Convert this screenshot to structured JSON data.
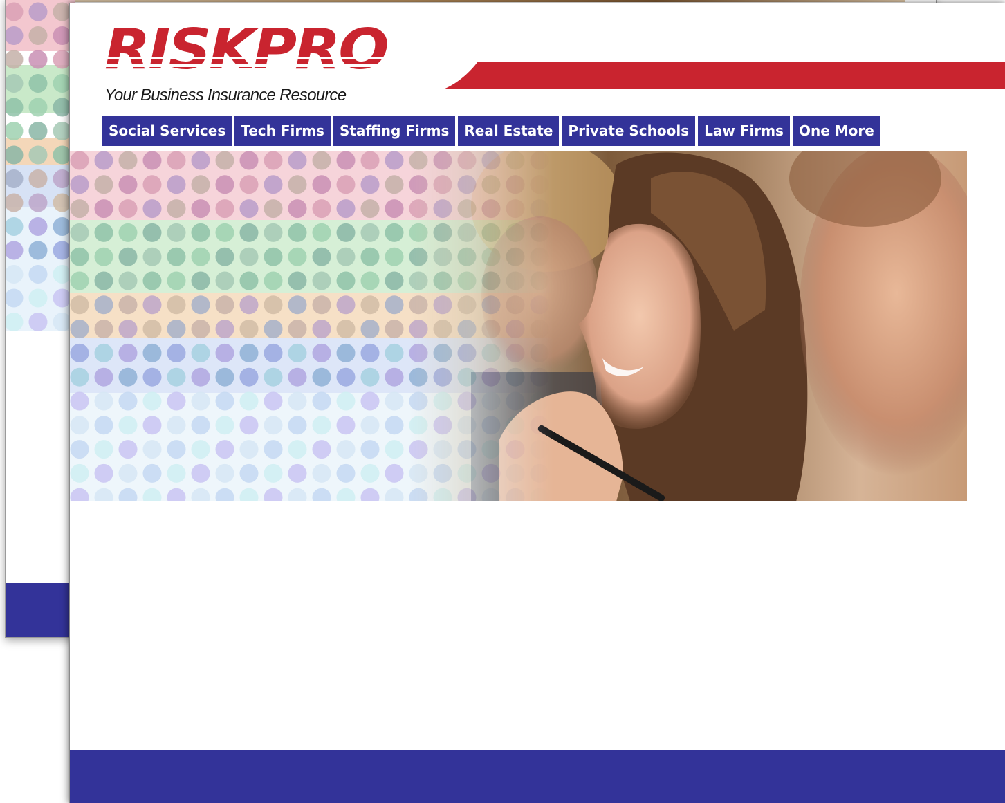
{
  "brand": {
    "logo_text": "RISKPRO",
    "tagline": "Your Business Insurance Resource",
    "red": "#c9242f",
    "navy": "#333399"
  },
  "nav": {
    "items": [
      {
        "label": "Social Services"
      },
      {
        "label": "Tech Firms"
      },
      {
        "label": "Staffing Firms"
      },
      {
        "label": "Real Estate"
      },
      {
        "label": "Private Schools"
      },
      {
        "label": "Law Firms"
      },
      {
        "label": "One More"
      }
    ]
  },
  "hero": {
    "image_icon": "people-photo-icon"
  }
}
